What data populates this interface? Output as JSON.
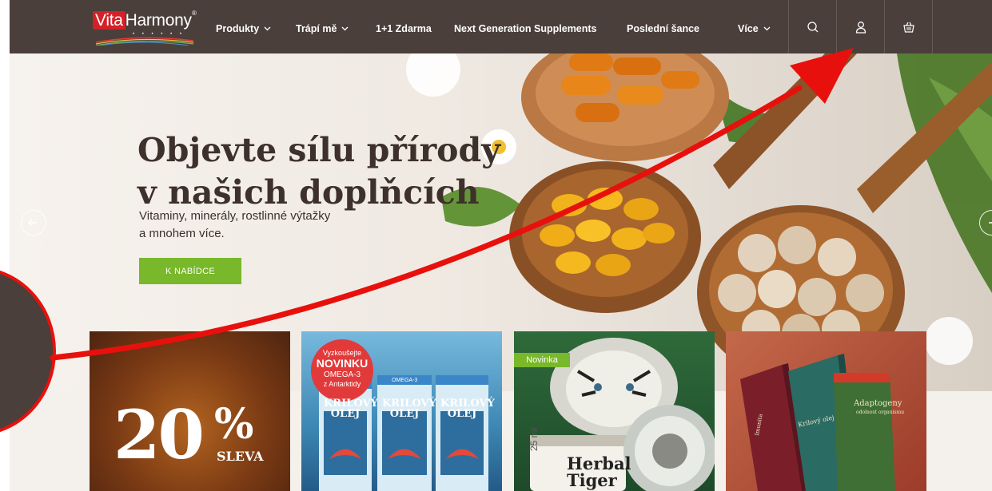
{
  "brand": {
    "name_part1": "Vita",
    "name_part2": "Harmony",
    "trademark": "®",
    "dots": "• • • • • •"
  },
  "nav": {
    "items": [
      {
        "label": "Produkty",
        "has_dropdown": true
      },
      {
        "label": "Trápí mě",
        "has_dropdown": true
      },
      {
        "label": "1+1 Zdarma",
        "has_dropdown": false
      },
      {
        "label": "Next Generation Supplements",
        "has_dropdown": false
      },
      {
        "label": "Poslední šance",
        "has_dropdown": false
      },
      {
        "label": "Více",
        "has_dropdown": true
      }
    ],
    "icons": [
      "search-icon",
      "user-icon",
      "basket-icon"
    ]
  },
  "hero": {
    "title_line1": "Objevte sílu přírody",
    "title_line2": "v našich doplňcích",
    "subtitle_line1": "Vitaminy, minerály, rostlinné výtažky",
    "subtitle_line2": "a mnohem více.",
    "cta_label": "K NABÍDCE"
  },
  "promos": {
    "sale": {
      "number": "20",
      "percent": "%",
      "label": "SLEVA"
    },
    "krill": {
      "badge_line1": "Vyzkoušejte",
      "badge_line2": "NOVINKU",
      "badge_line3": "OMEGA-3",
      "badge_line4": "z Antarktidy",
      "box_label_line1": "KRILOVÝ",
      "box_label_line2": "OLEJ",
      "box_header": "OMEGA-3"
    },
    "tiger": {
      "tag": "Novinka",
      "product_line1": "Herbal",
      "product_line2": "Tiger",
      "volume": "25 ml"
    },
    "boxes": {
      "label_adapt": "Adaptogeny",
      "label_adapt_sub": "odolnost organismu",
      "label_krill": "Krilový olej",
      "label_imunita": "Imunita"
    }
  },
  "colors": {
    "nav_bg": "#4a3f3a",
    "cta_green": "#78b82a",
    "brand_red": "#d42027",
    "annotation_red": "#e8100c"
  }
}
